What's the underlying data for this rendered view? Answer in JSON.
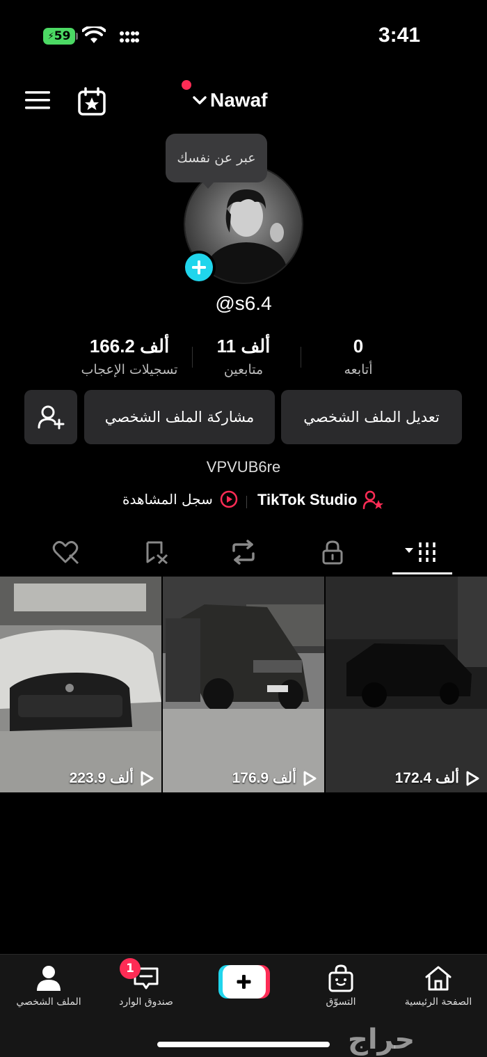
{
  "status_bar": {
    "battery": "59",
    "time": "3:41"
  },
  "header": {
    "username": "Nawaf"
  },
  "profile": {
    "bio_prompt": "عبر عن نفسك",
    "handle": "@s6.4",
    "bio": "VPVUB6re"
  },
  "stats": [
    {
      "value": "0",
      "label": "أتابعه"
    },
    {
      "value": "11 ألف",
      "label": "متابعين"
    },
    {
      "value": "166.2 ألف",
      "label": "تسجيلات الإعجاب"
    }
  ],
  "actions": {
    "edit": "تعديل الملف الشخصي",
    "share": "مشاركة الملف الشخصي"
  },
  "links": {
    "studio": "TikTok Studio",
    "history": "سجل المشاهدة"
  },
  "videos": [
    {
      "views": "223.9 ألف"
    },
    {
      "views": "176.9 ألف"
    },
    {
      "views": "172.4 ألف"
    }
  ],
  "nav": {
    "home": "الصفحة الرئيسية",
    "shop": "التسوّق",
    "inbox": "صندوق الوارد",
    "inbox_badge": "1",
    "profile": "الملف الشخصي"
  },
  "watermark": "حراج",
  "colors": {
    "accent": "#fe2c55",
    "cyan": "#20d5ec",
    "background": "#000000"
  }
}
